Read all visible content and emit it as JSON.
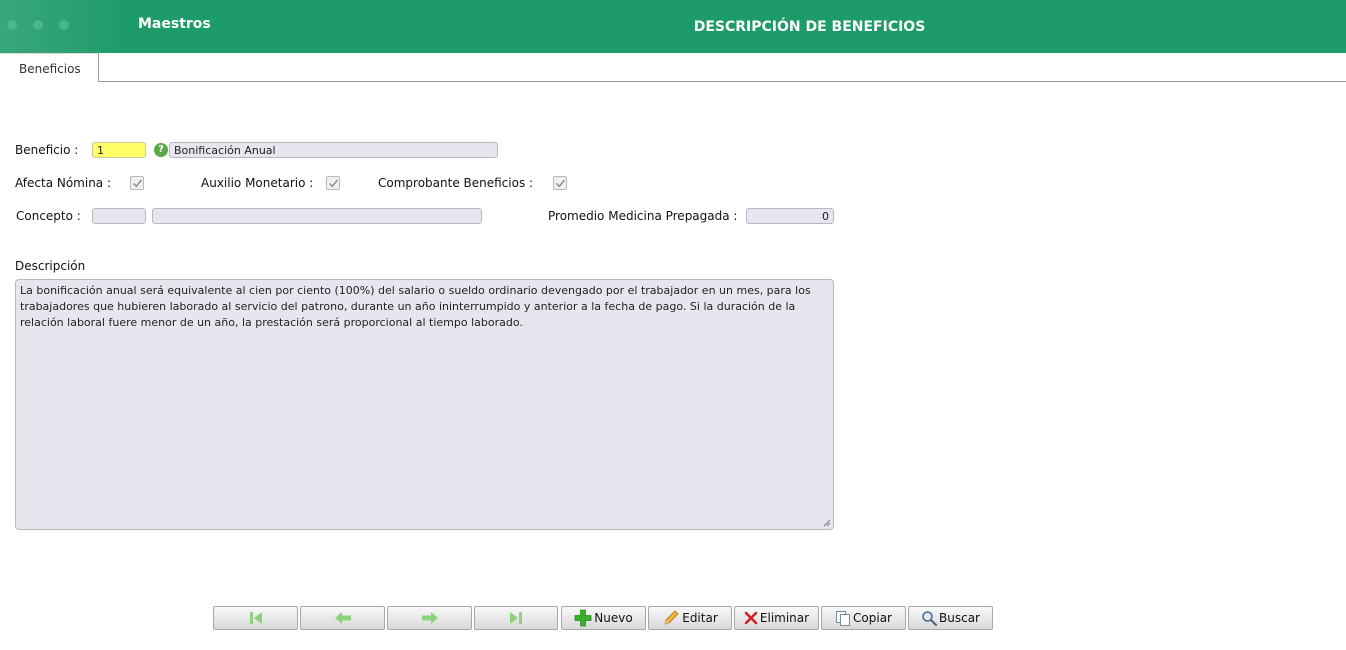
{
  "header": {
    "app_title": "Maestros",
    "page_title": "DESCRIPCIÓN DE BENEFICIOS",
    "color": "#1e9b6a"
  },
  "tabs": [
    {
      "label": "Beneficios"
    }
  ],
  "form": {
    "beneficio_label": "Beneficio :",
    "beneficio_code": "1",
    "beneficio_name": "Bonificación Anual",
    "afecta_nomina_label": "Afecta Nómina :",
    "afecta_nomina_checked": true,
    "auxilio_monetario_label": "Auxilio Monetario :",
    "auxilio_monetario_checked": true,
    "comprobante_label": "Comprobante Beneficios :",
    "comprobante_checked": true,
    "concepto_label": "Concepto :",
    "concepto_code": "",
    "concepto_name": "",
    "promedio_label": "Promedio Medicina Prepagada :",
    "promedio_value": "0",
    "descripcion_label": "Descripción",
    "descripcion_text": "La bonificación anual será equivalente al cien por ciento (100%) del salario o sueldo ordinario devengado por el trabajador en un mes, para los trabajadores que hubieren laborado al servicio del patrono, durante un año ininterrumpido y anterior a la fecha de pago. Si la duración de la relación laboral fuere menor de un año, la prestación será proporcional al tiempo laborado."
  },
  "toolbar": {
    "nuevo": "Nuevo",
    "editar": "Editar",
    "eliminar": "Eliminar",
    "copiar": "Copiar",
    "buscar": "Buscar"
  }
}
